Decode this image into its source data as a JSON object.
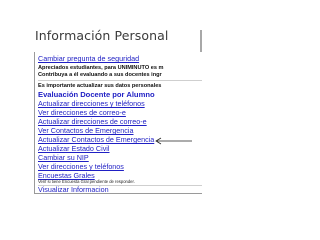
{
  "slide_title": "Información Personal",
  "panel": {
    "top_link": "Cambiar pregunta de seguridad",
    "notice_line_1": "Apreciados estudiantes, para UNIMINUTO es m",
    "notice_line_2": "Contribuya a él evaluando a sus docentes ingr",
    "notice_line_3": "Es importante actualizar sus datos personales",
    "section_header": "Evaluación Docente por Alumno",
    "links": [
      "Actualizar direcciones y teléfonos",
      "Ver direcciones de correo-e",
      "Actualizar direcciones de correo-e",
      "Ver Contactos de Emergencia",
      "Actualizar Contactos de Emergencia",
      "Actualizar Estado Civil",
      "Cambiar su NIP",
      "Ver direcciones y teléfonos",
      "Encuestas Grales"
    ],
    "survey_note": "Verif si tiene Encuesta Gral pendiente de responder.",
    "bottom_link": "Visualizar Informacion"
  },
  "colors": {
    "link": "#1f1fc4",
    "title": "#3b3b3b"
  }
}
